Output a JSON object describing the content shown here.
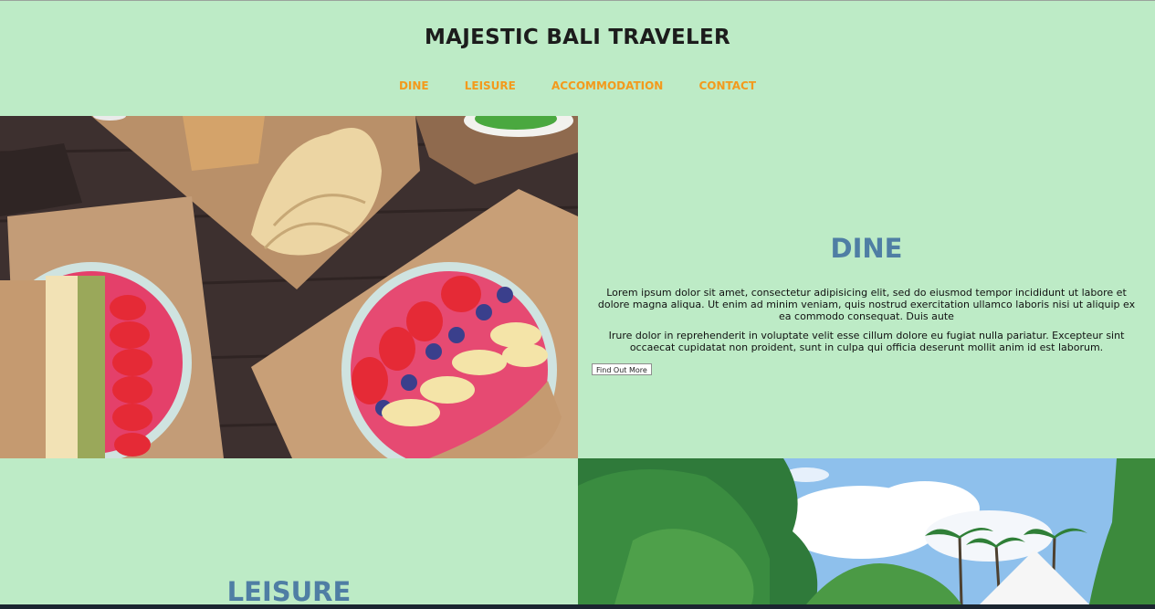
{
  "header": {
    "title": "MAJESTIC BALI TRAVELER",
    "nav": [
      "DINE",
      "LEISURE",
      "ACCOMMODATION",
      "CONTACT"
    ]
  },
  "dine": {
    "title": "DINE",
    "paragraph1": "Lorem ipsum dolor sit amet, consectetur adipisicing elit, sed do eiusmod tempor incididunt ut labore et dolore magna aliqua. Ut enim ad minim veniam, quis nostrud exercitation ullamco laboris nisi ut aliquip ex ea commodo consequat. Duis aute",
    "paragraph2": "Irure dolor in reprehenderit in voluptate velit esse cillum dolore eu fugiat nulla pariatur. Excepteur sint occaecat cupidatat non proident, sunt in culpa qui officia deserunt mollit anim id est laborum.",
    "button_label": "Find Out More"
  },
  "leisure": {
    "title": "LEISURE"
  },
  "colors": {
    "background": "#bdebc6",
    "nav_link": "#f39a1c",
    "section_title": "#4f7ea4"
  },
  "images": {
    "dine": "food-photo-smoothie-bowls",
    "leisure": "tropical-palm-trees-photo"
  }
}
